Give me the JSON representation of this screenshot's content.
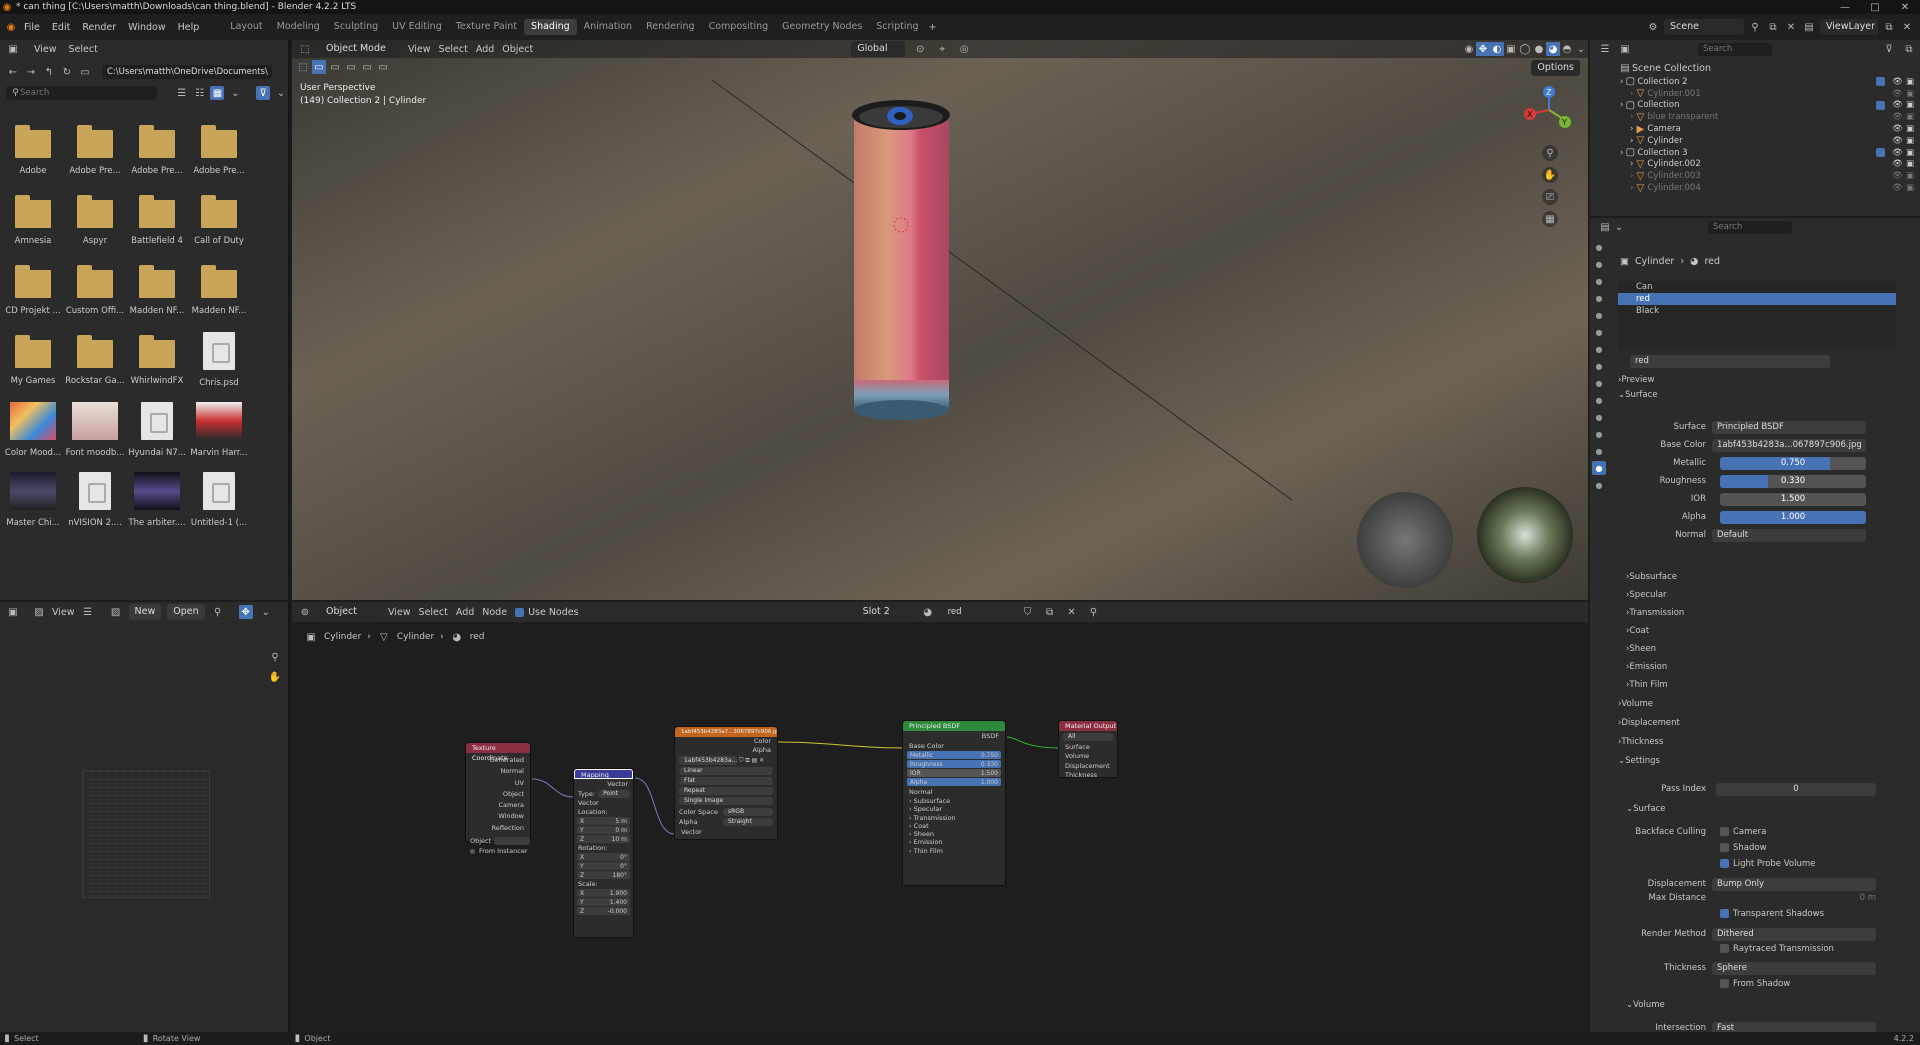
{
  "window": {
    "title": "* can thing [C:\\Users\\matth\\Downloads\\can thing.blend] - Blender 4.2.2 LTS"
  },
  "menu": {
    "items": [
      "File",
      "Edit",
      "Render",
      "Window",
      "Help"
    ]
  },
  "workspaces": [
    {
      "label": "Layout",
      "active": false
    },
    {
      "label": "Modeling",
      "active": false
    },
    {
      "label": "Sculpting",
      "active": false
    },
    {
      "label": "UV Editing",
      "active": false
    },
    {
      "label": "Texture Paint",
      "active": false
    },
    {
      "label": "Shading",
      "active": true
    },
    {
      "label": "Animation",
      "active": false
    },
    {
      "label": "Rendering",
      "active": false
    },
    {
      "label": "Compositing",
      "active": false
    },
    {
      "label": "Geometry Nodes",
      "active": false
    },
    {
      "label": "Scripting",
      "active": false
    }
  ],
  "topright": {
    "scene": "Scene",
    "viewlayer": "ViewLayer",
    "add": "+"
  },
  "filebrowser": {
    "view": "View",
    "select": "Select",
    "path": "C:\\Users\\matth\\OneDrive\\Documents\\",
    "search_placeholder": "Search",
    "items": [
      {
        "label": "Adobe",
        "kind": "folder"
      },
      {
        "label": "Adobe Pre...",
        "kind": "folder"
      },
      {
        "label": "Adobe Pre...",
        "kind": "folder"
      },
      {
        "label": "Adobe Pre...",
        "kind": "folder"
      },
      {
        "label": "Amnesia",
        "kind": "folder"
      },
      {
        "label": "Aspyr",
        "kind": "folder"
      },
      {
        "label": "Battlefield 4",
        "kind": "folder"
      },
      {
        "label": "Call of Duty",
        "kind": "folder"
      },
      {
        "label": "CD Projekt ...",
        "kind": "folder"
      },
      {
        "label": "Custom Offi...",
        "kind": "folder"
      },
      {
        "label": "Madden NF...",
        "kind": "folder"
      },
      {
        "label": "Madden NF...",
        "kind": "folder"
      },
      {
        "label": "My Games",
        "kind": "folder"
      },
      {
        "label": "Rockstar Ga...",
        "kind": "folder"
      },
      {
        "label": "WhirlwindFX",
        "kind": "folder"
      },
      {
        "label": "Chris.psd",
        "kind": "doc"
      },
      {
        "label": "Color Mood...",
        "kind": "img1"
      },
      {
        "label": "Font moodb...",
        "kind": "img2"
      },
      {
        "label": "Hyundai N7...",
        "kind": "doc"
      },
      {
        "label": "Marvin Harr...",
        "kind": "img3"
      },
      {
        "label": "Master Chi...",
        "kind": "img4"
      },
      {
        "label": "nVISION 2....",
        "kind": "doc"
      },
      {
        "label": "The arbiter....",
        "kind": "img5"
      },
      {
        "label": "Untitled-1 (...",
        "kind": "doc"
      }
    ]
  },
  "viewport": {
    "mode": "Object Mode",
    "view": "View",
    "select": "Select",
    "add": "Add",
    "object": "Object",
    "orientation": "Global",
    "options": "Options",
    "overlay_line1": "User Perspective",
    "overlay_line2": "(149) Collection 2 | Cylinder",
    "gizmo": {
      "x": "X",
      "y": "Y",
      "z": "Z"
    }
  },
  "node_editor": {
    "object": "Object",
    "view": "View",
    "select": "Select",
    "add": "Add",
    "node": "Node",
    "use_nodes": "Use Nodes",
    "slot": "Slot 2",
    "material": "red",
    "breadcrumb": [
      "Cylinder",
      "Cylinder",
      "red"
    ],
    "tex_coord": {
      "title": "Texture Coordinate",
      "outputs": [
        "Generated",
        "Normal",
        "UV",
        "Object",
        "Camera",
        "Window",
        "Reflection"
      ],
      "object_label": "Object",
      "from_instancer": "From Instancer"
    },
    "mapping": {
      "title": "Mapping",
      "vector_out": "Vector",
      "type_label": "Type:",
      "type": "Point",
      "vector_in": "Vector",
      "location": "Location:",
      "loc": [
        "5 m",
        "0 m",
        "10 m"
      ],
      "rotation": "Rotation:",
      "rot": [
        "0°",
        "0°",
        "180°"
      ],
      "scale": "Scale:",
      "scl": [
        "1.900",
        "1.400",
        "-0.000"
      ],
      "axes": [
        "X",
        "Y",
        "Z"
      ]
    },
    "image": {
      "title": "1abf453b4283a7...3067897c906.jpg",
      "color": "Color",
      "alpha": "Alpha",
      "file": "1abf453b4283a...",
      "interp": "Linear",
      "proj": "Flat",
      "ext": "Repeat",
      "src": "Single Image",
      "cs_label": "Color Space",
      "cs": "sRGB",
      "alpha_label": "Alpha",
      "alpha_mode": "Straight",
      "vector": "Vector"
    },
    "bsdf": {
      "title": "Principled BSDF",
      "out": "BSDF",
      "base": "Base Color",
      "rows": [
        {
          "label": "Metallic",
          "value": "0.750"
        },
        {
          "label": "Roughness",
          "value": "0.330"
        },
        {
          "label": "IOR",
          "value": "1.500"
        },
        {
          "label": "Alpha",
          "value": "1.000"
        }
      ],
      "normal": "Normal",
      "subs": [
        "Subsurface",
        "Specular",
        "Transmission",
        "Coat",
        "Sheen",
        "Emission",
        "Thin Film"
      ]
    },
    "output": {
      "title": "Material Output",
      "target": "All",
      "inputs": [
        "Surface",
        "Volume",
        "Displacement",
        "Thickness"
      ]
    }
  },
  "uv": {
    "view": "View",
    "new": "New",
    "open": "Open"
  },
  "outliner": {
    "search_placeholder": "Search",
    "root": "Scene Collection",
    "rows": [
      {
        "label": "Collection 2",
        "indent": 1,
        "type": "collection"
      },
      {
        "label": "Cylinder.001",
        "indent": 2,
        "type": "mesh",
        "dim": true
      },
      {
        "label": "Collection",
        "indent": 1,
        "type": "collection"
      },
      {
        "label": "blue transparent",
        "indent": 2,
        "type": "mesh",
        "dim": true
      },
      {
        "label": "Camera",
        "indent": 2,
        "type": "camera"
      },
      {
        "label": "Cylinder",
        "indent": 2,
        "type": "mesh"
      },
      {
        "label": "Collection 3",
        "indent": 1,
        "type": "collection"
      },
      {
        "label": "Cylinder.002",
        "indent": 2,
        "type": "mesh"
      },
      {
        "label": "Cylinder.003",
        "indent": 2,
        "type": "mesh",
        "dim": true
      },
      {
        "label": "Cylinder.004",
        "indent": 2,
        "type": "mesh",
        "dim": true
      }
    ]
  },
  "properties": {
    "search_placeholder": "Search",
    "crumb_obj": "Cylinder",
    "crumb_mat": "red",
    "slots": [
      "Can",
      "red",
      "Black"
    ],
    "material_name": "red",
    "preview": "Preview",
    "surface": "Surface",
    "surface_label": "Surface",
    "surface_value": "Principled BSDF",
    "base_color_label": "Base Color",
    "base_color_value": "1abf453b4283a...067897c906.jpg",
    "sliders": [
      {
        "label": "Metallic",
        "value": "0.750",
        "frac": 0.75
      },
      {
        "label": "Roughness",
        "value": "0.330",
        "frac": 0.33
      },
      {
        "label": "IOR",
        "value": "1.500",
        "frac": 0
      },
      {
        "label": "Alpha",
        "value": "1.000",
        "frac": 1.0
      }
    ],
    "normal_label": "Normal",
    "normal_value": "Default",
    "subpanels": [
      "Subsurface",
      "Specular",
      "Transmission",
      "Coat",
      "Sheen",
      "Emission",
      "Thin Film"
    ],
    "volume": "Volume",
    "displacement": "Displacement",
    "thickness": "Thickness",
    "settings": "Settings",
    "pass_index_label": "Pass Index",
    "pass_index": "0",
    "surface_sub": "Surface",
    "backface_label": "Backface Culling",
    "camera": "Camera",
    "shadow": "Shadow",
    "light_probe": "Light Probe Volume",
    "displacement_label": "Displacement",
    "displacement_value": "Bump Only",
    "max_distance_label": "Max Distance",
    "max_distance": "0 m",
    "transparent_shadows": "Transparent Shadows",
    "render_method_label": "Render Method",
    "render_method": "Dithered",
    "raytraced": "Raytraced Transmission",
    "thickness_label": "Thickness",
    "thickness_value": "Sphere",
    "from_shadow": "From Shadow",
    "volume_sub": "Volume",
    "intersection_label": "Intersection",
    "intersection": "Fast"
  },
  "status": {
    "select": "Select",
    "rotate": "Rotate View",
    "object": "Object",
    "version": "4.2.2"
  },
  "colors": {
    "accent": "#4772b3",
    "folder": "#c9a55a",
    "shader_header": "#2e8a3a",
    "texture_header": "#c2651f",
    "input_header": "#8c2e42",
    "vector_header": "#3a3a9a",
    "output_header": "#8c2e42"
  }
}
